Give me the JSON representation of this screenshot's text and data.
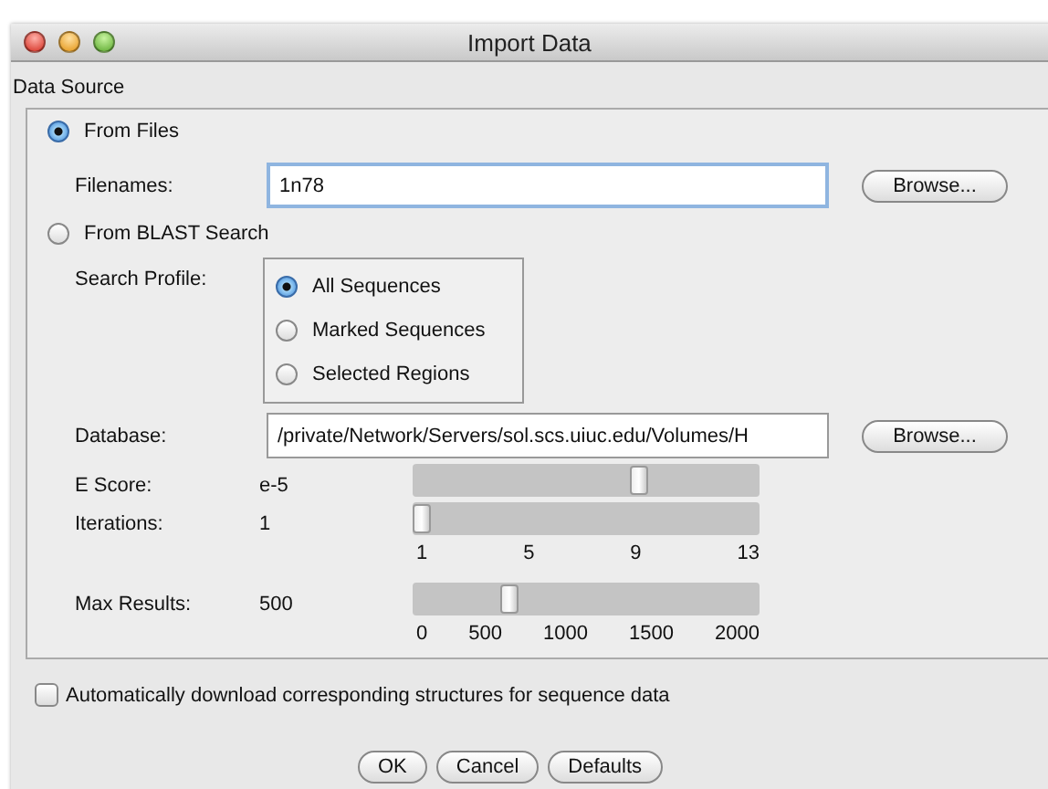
{
  "window": {
    "title": "Import Data"
  },
  "data_source": {
    "label": "Data Source",
    "from_files": {
      "label": "From Files",
      "selected": true,
      "filenames": {
        "label": "Filenames:",
        "value": "1n78",
        "browse": "Browse..."
      }
    },
    "from_blast": {
      "label": "From BLAST Search",
      "selected": false,
      "search_profile": {
        "label": "Search Profile:",
        "options": [
          {
            "label": "All Sequences",
            "selected": true
          },
          {
            "label": "Marked Sequences",
            "selected": false
          },
          {
            "label": "Selected Regions",
            "selected": false
          }
        ]
      },
      "database": {
        "label": "Database:",
        "value": "/private/Network/Servers/sol.scs.uiuc.edu/Volumes/H",
        "browse": "Browse..."
      },
      "sliders": [
        {
          "label": "E Score:",
          "reading": "e-5",
          "level": 0.67
        },
        {
          "label": "Iterations:",
          "reading": "1",
          "level": 0.0,
          "ticks": [
            "1",
            "5",
            "9",
            "13"
          ]
        },
        {
          "label": "Max Results:",
          "reading": "500",
          "level": 0.27,
          "ticks": [
            "0",
            "500",
            "1000",
            "1500",
            "2000"
          ]
        }
      ]
    }
  },
  "auto_download": {
    "label": "Automatically download corresponding structures for sequence data",
    "checked": false
  },
  "buttons": [
    "OK",
    "Cancel",
    "Defaults"
  ]
}
